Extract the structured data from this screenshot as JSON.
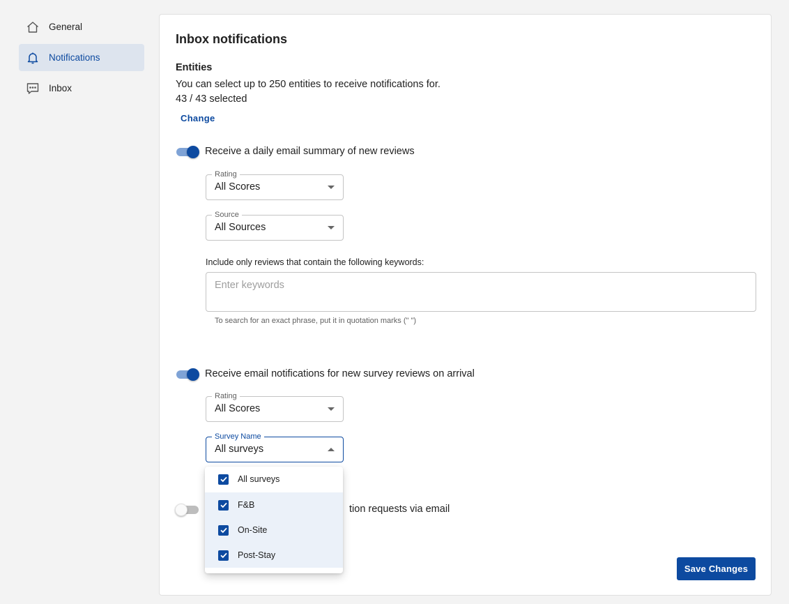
{
  "sidebar": {
    "items": [
      {
        "label": "General",
        "icon": "home-icon"
      },
      {
        "label": "Notifications",
        "icon": "bell-icon",
        "active": true
      },
      {
        "label": "Inbox",
        "icon": "chat-icon"
      }
    ]
  },
  "main": {
    "title": "Inbox notifications",
    "entities": {
      "title": "Entities",
      "description": "You can select up to 250 entities to receive notifications for.",
      "count": "43 / 43 selected",
      "change_label": "Change"
    },
    "daily_summary": {
      "enabled": true,
      "label": "Receive a daily email summary of new reviews",
      "rating": {
        "legend": "Rating",
        "value": "All Scores"
      },
      "source": {
        "legend": "Source",
        "value": "All Sources"
      },
      "keywords": {
        "label": "Include only reviews that contain the following keywords:",
        "placeholder": "Enter keywords",
        "value": "",
        "help": "To search for an exact phrase, put it in quotation marks (\" \")"
      }
    },
    "survey_notifications": {
      "enabled": true,
      "label": "Receive email notifications for new survey reviews on arrival",
      "rating": {
        "legend": "Rating",
        "value": "All Scores"
      },
      "survey_name": {
        "legend": "Survey Name",
        "value": "All surveys"
      }
    },
    "third_toggle": {
      "enabled": false,
      "label_visible": "tion requests via email"
    },
    "save_label": "Save Changes"
  },
  "survey_menu": {
    "options": [
      {
        "label": "All surveys",
        "checked": true
      },
      {
        "label": "F&B",
        "checked": true
      },
      {
        "label": "On-Site",
        "checked": true
      },
      {
        "label": "Post-Stay",
        "checked": true
      }
    ]
  },
  "colors": {
    "accent": "#0d4aa0",
    "sidebar_active_bg": "#dde4ee",
    "page_bg": "#f3f3f3",
    "selected_row_bg": "#ebf1f9"
  }
}
